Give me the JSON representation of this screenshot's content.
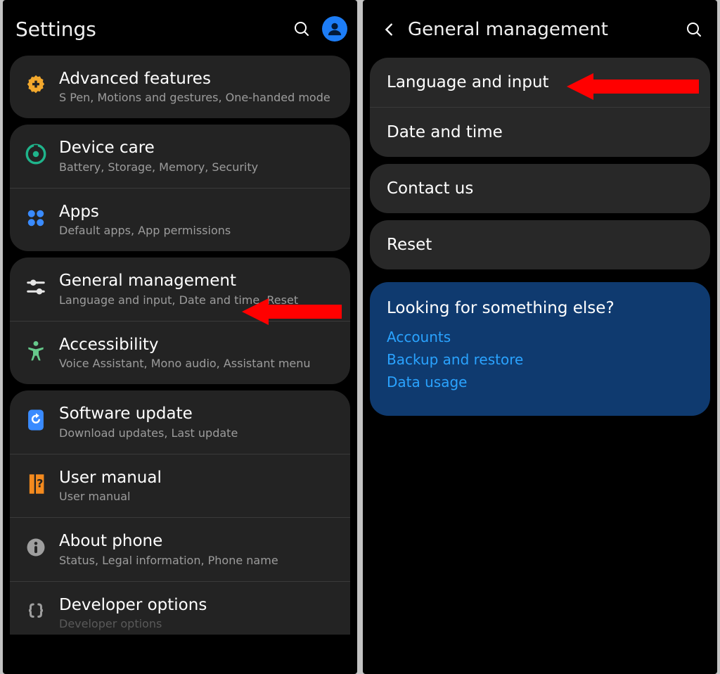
{
  "left": {
    "title": "Settings",
    "group1": {
      "advanced": {
        "title": "Advanced features",
        "sub": "S Pen, Motions and gestures, One-handed mode"
      }
    },
    "group2": {
      "devicecare": {
        "title": "Device care",
        "sub": "Battery, Storage, Memory, Security"
      },
      "apps": {
        "title": "Apps",
        "sub": "Default apps, App permissions"
      }
    },
    "group3": {
      "general": {
        "title": "General management",
        "sub": "Language and input, Date and time, Reset"
      },
      "accessibility": {
        "title": "Accessibility",
        "sub": "Voice Assistant, Mono audio, Assistant menu"
      }
    },
    "group4": {
      "software": {
        "title": "Software update",
        "sub": "Download updates, Last update"
      },
      "usermanual": {
        "title": "User manual",
        "sub": "User manual"
      },
      "about": {
        "title": "About phone",
        "sub": "Status, Legal information, Phone name"
      },
      "developer": {
        "title": "Developer options",
        "sub": "Developer options"
      }
    }
  },
  "right": {
    "title": "General management",
    "lang": "Language and input",
    "date": "Date and time",
    "contact": "Contact us",
    "reset": "Reset",
    "sugtitle": "Looking for something else?",
    "sug1": "Accounts",
    "sug2": "Backup and restore",
    "sug3": "Data usage"
  },
  "colors": {
    "accent_blue": "#1d7df6",
    "arrow_red": "#ff0000",
    "sug_bg": "#0f3a6f",
    "card_bg": "#232323"
  }
}
